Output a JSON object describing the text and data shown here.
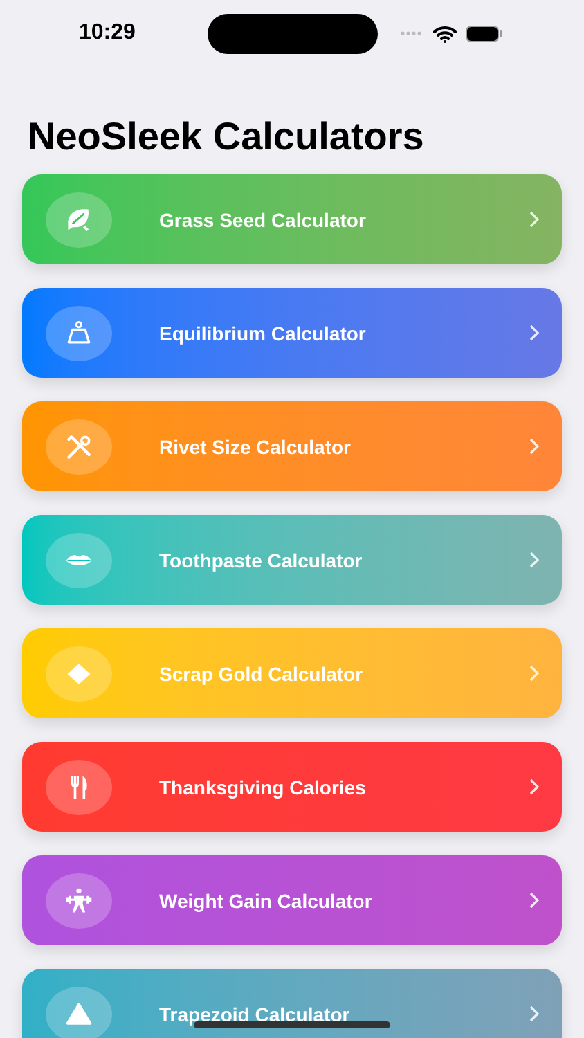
{
  "status_bar": {
    "time": "10:29"
  },
  "title": "NeoSleek Calculators",
  "rows": [
    {
      "kind": "leaf",
      "label": "Grass Seed Calculator",
      "color": "#34c759"
    },
    {
      "kind": "scale",
      "label": "Equilibrium Calculator",
      "color": "#007aff"
    },
    {
      "kind": "tools",
      "label": "Rivet Size Calculator",
      "color": "#ff9500"
    },
    {
      "kind": "lips",
      "label": "Toothpaste Calculator",
      "color": "#00c7be"
    },
    {
      "kind": "diamond",
      "label": "Scrap Gold Calculator",
      "color": "#ffcc00"
    },
    {
      "kind": "cutlery",
      "label": "Thanksgiving Calories",
      "color": "#ff3b30"
    },
    {
      "kind": "lifter",
      "label": "Weight Gain Calculator",
      "color": "#af52de"
    },
    {
      "kind": "triangle",
      "label": "Trapezoid Calculator",
      "color": "#30b0c7"
    }
  ]
}
